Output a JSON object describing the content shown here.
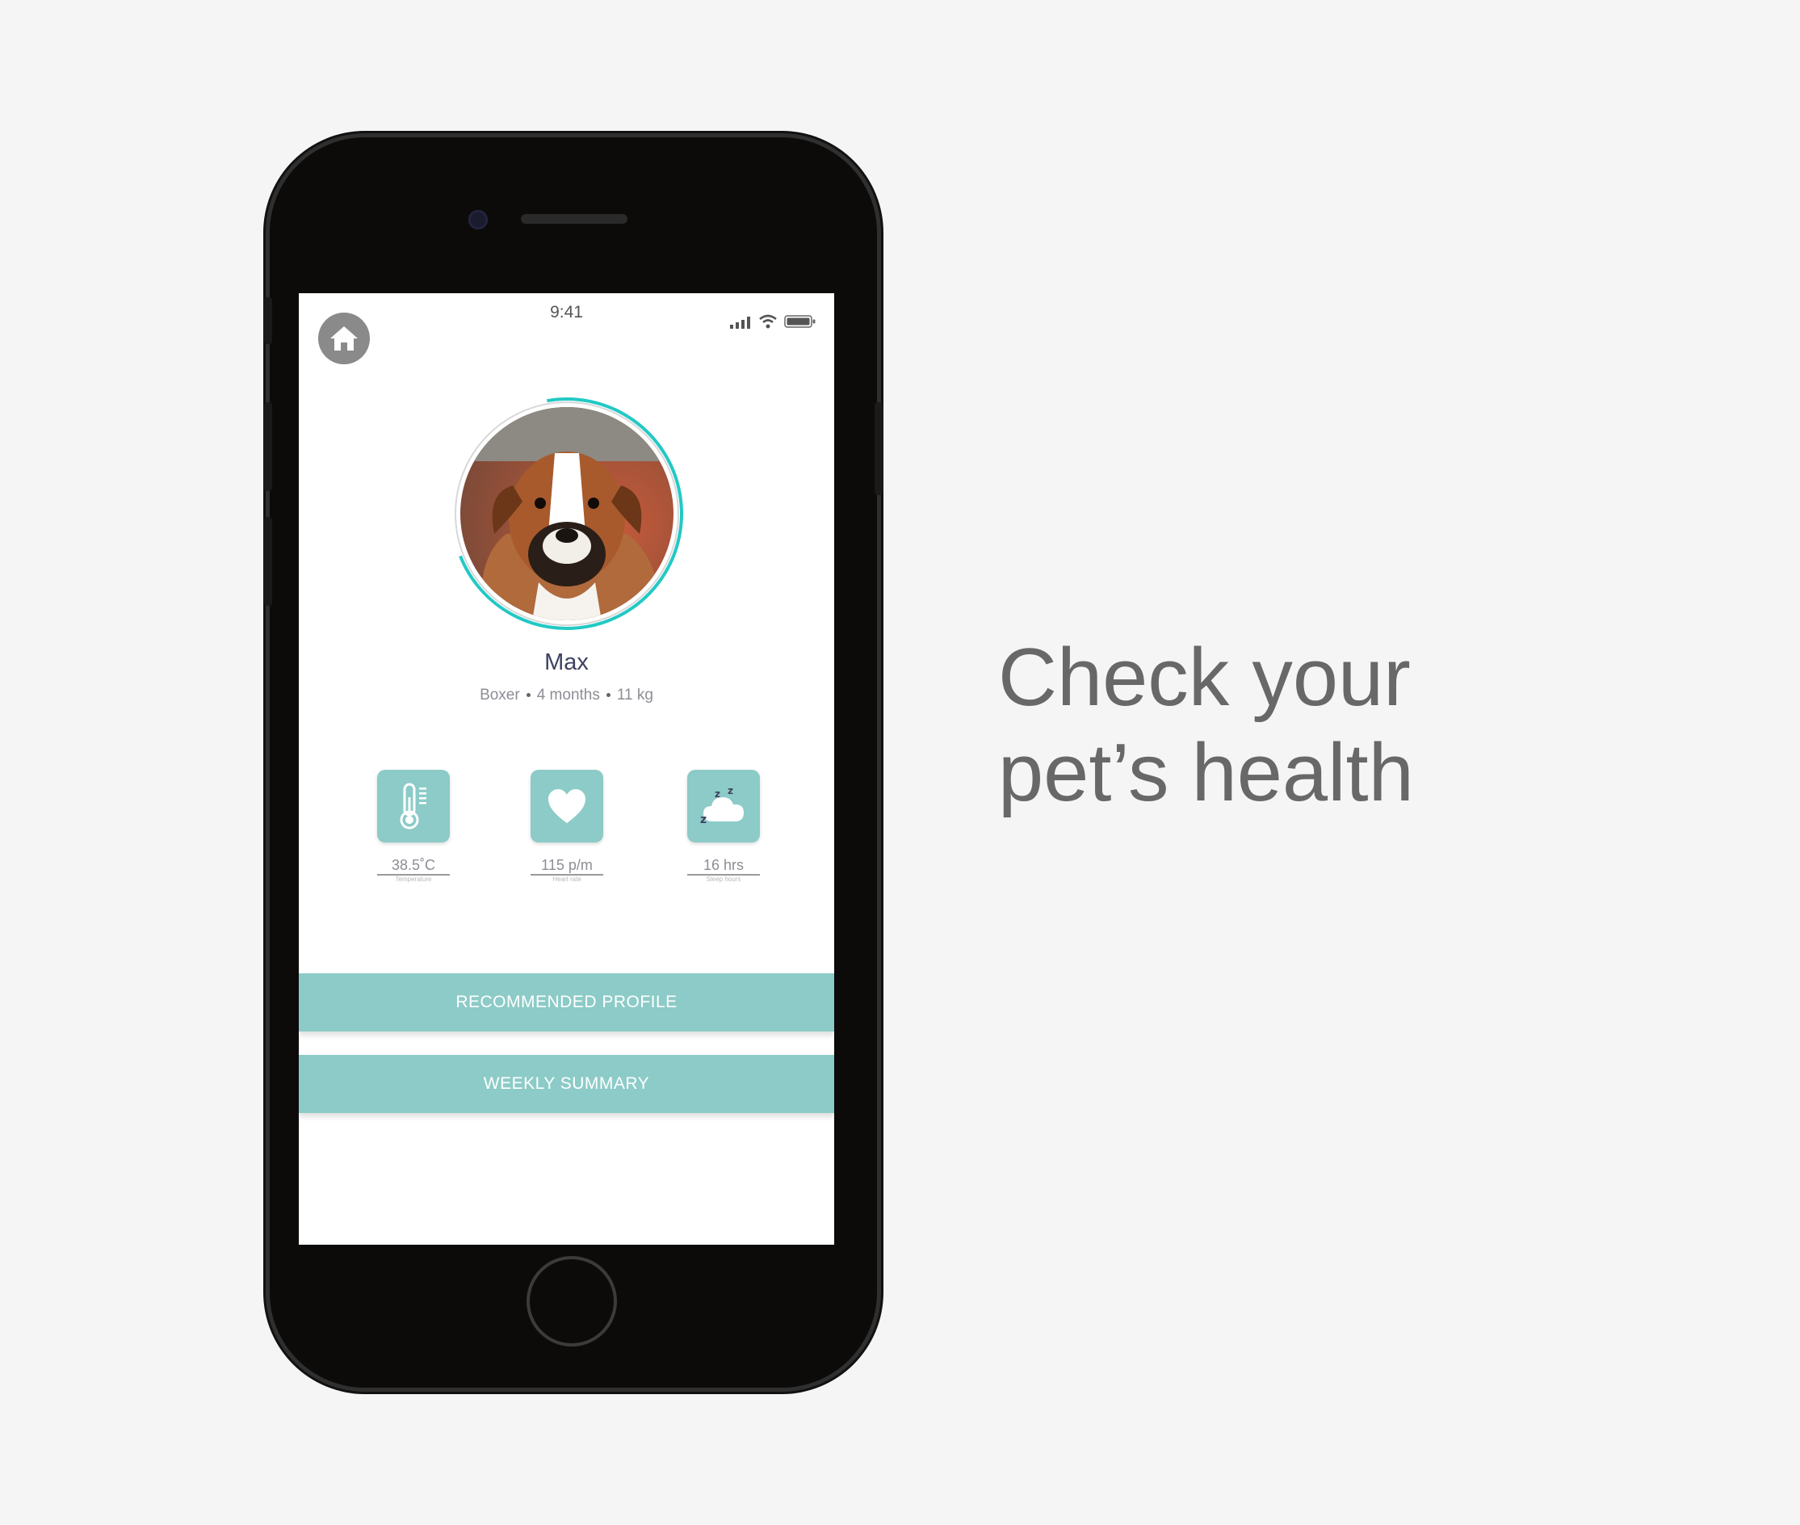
{
  "status_bar": {
    "time": "9:41"
  },
  "pet": {
    "name": "Max",
    "breed": "Boxer",
    "age": "4 months",
    "weight": "11 kg",
    "ring_progress": 0.72
  },
  "metrics": [
    {
      "icon": "thermometer-icon",
      "value": "38.5˚C",
      "caption": "Temperature"
    },
    {
      "icon": "heart-icon",
      "value": "115 p/m",
      "caption": "Heart rate"
    },
    {
      "icon": "sleep-cloud-icon",
      "value": "16 hrs",
      "caption": "Sleep hours"
    }
  ],
  "actions": {
    "recommended_profile": "RECOMMENDED PROFILE",
    "weekly_summary": "WEEKLY SUMMARY"
  },
  "headline": {
    "line1": "Check your",
    "line2": "pet’s health"
  },
  "colors": {
    "accent": "#8ccbc7",
    "ring": "#22c9c4",
    "background": "#f5f5f5",
    "headline": "#686868"
  }
}
